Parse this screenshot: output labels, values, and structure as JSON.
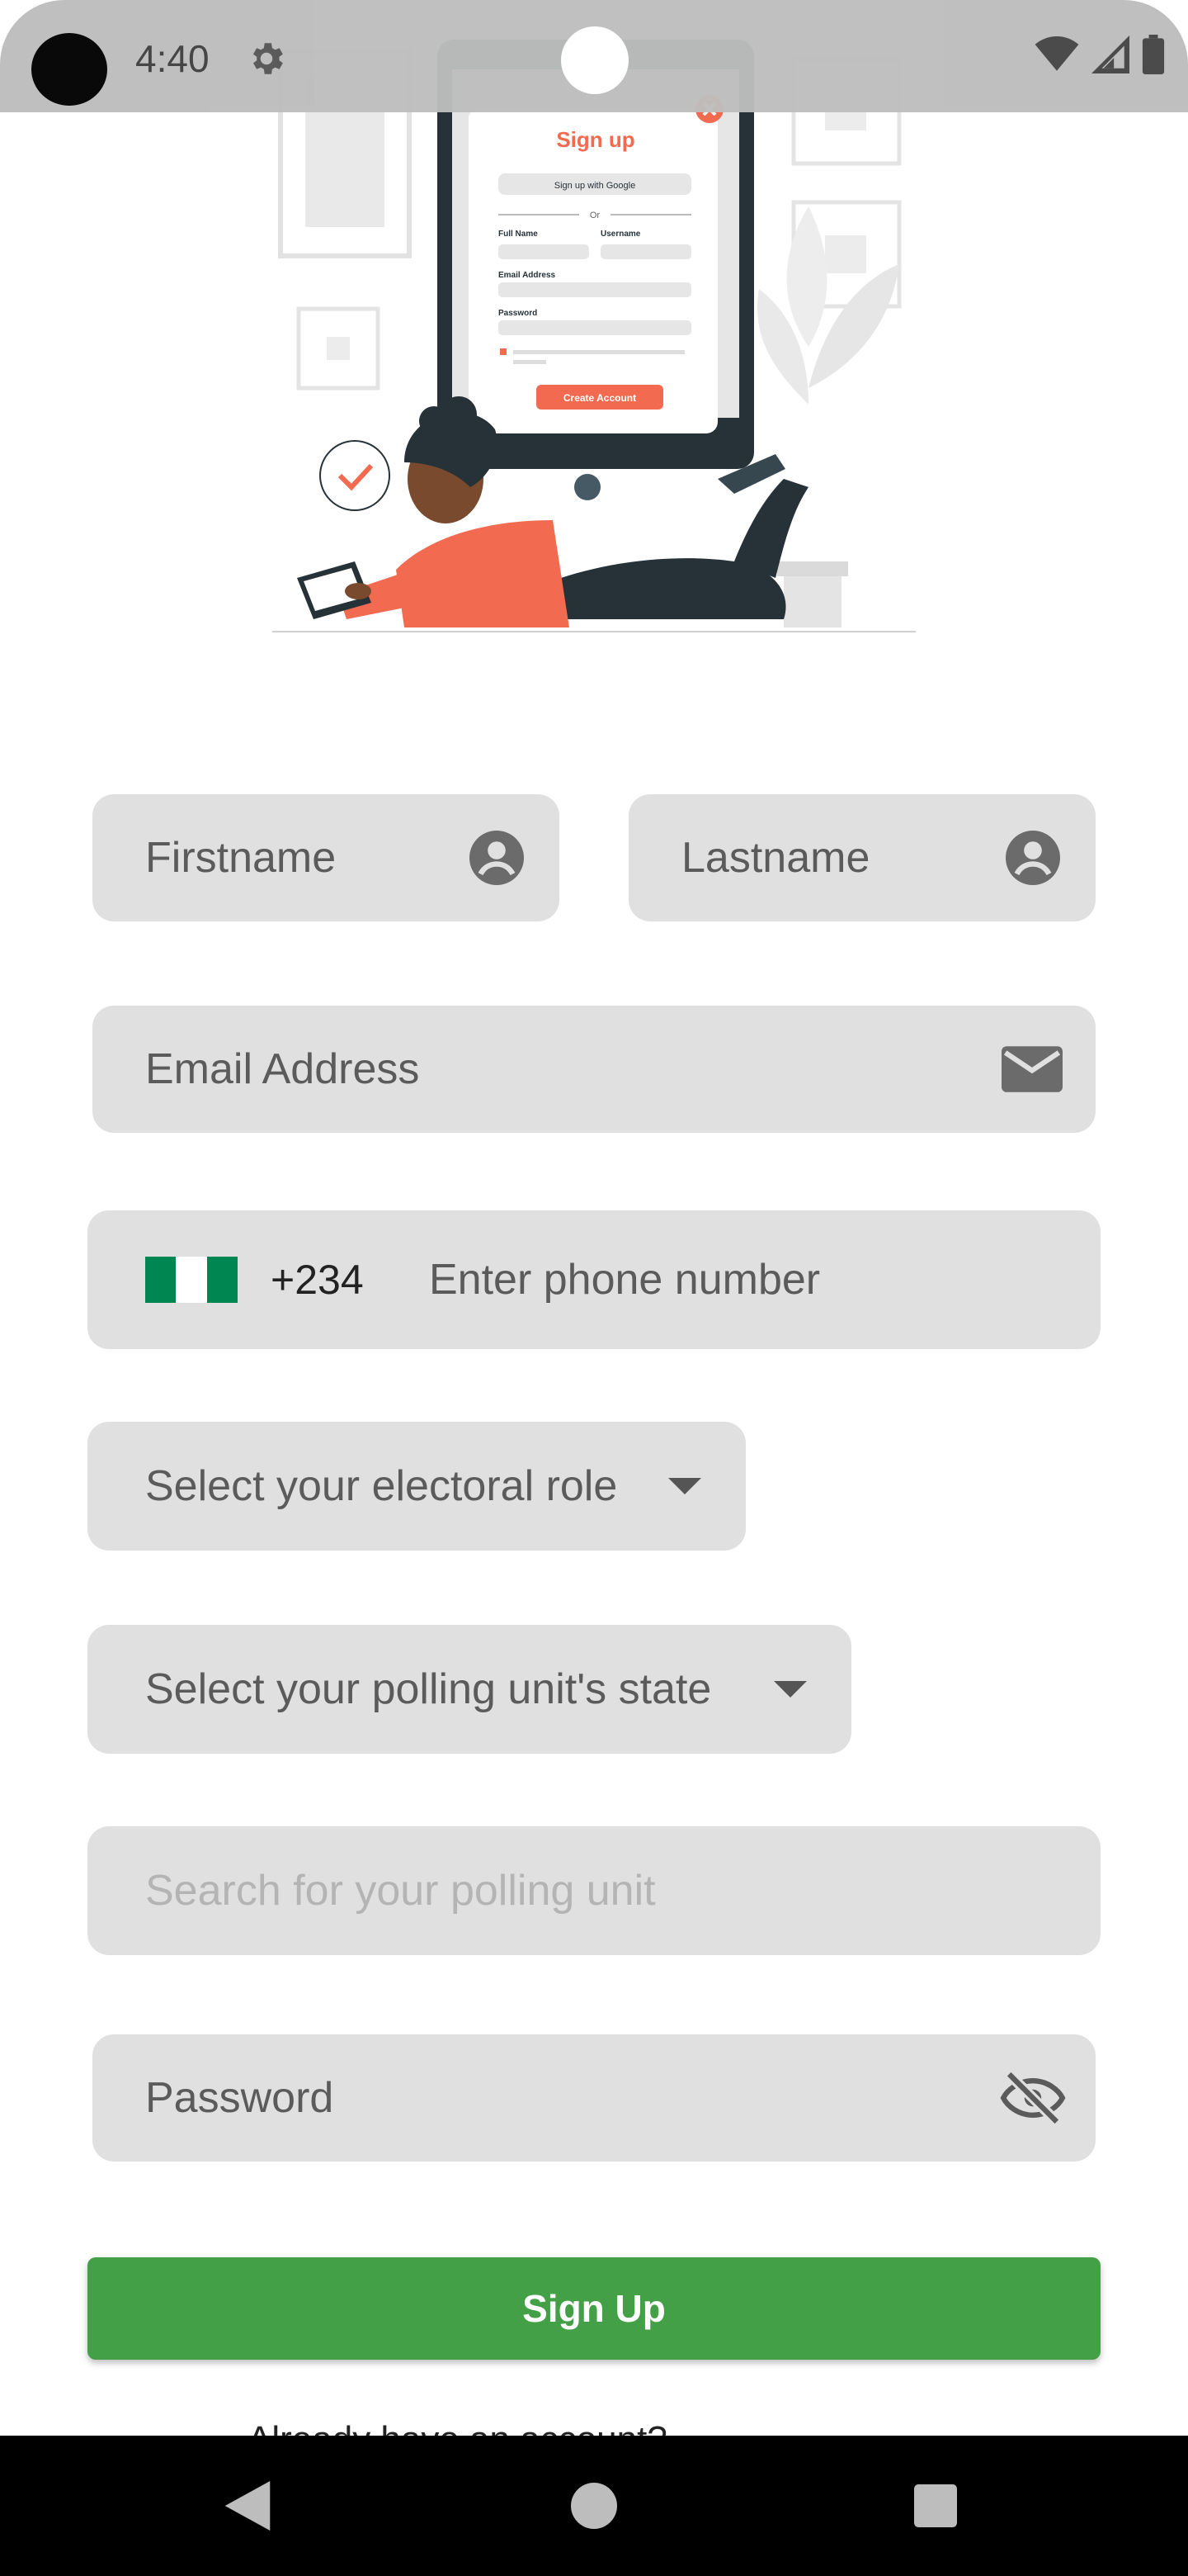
{
  "status_bar": {
    "time": "4:40"
  },
  "form": {
    "firstname_placeholder": "Firstname",
    "lastname_placeholder": "Lastname",
    "email_placeholder": "Email Address",
    "phone": {
      "country_code": "+234",
      "placeholder": "Enter phone number",
      "flag": "nigeria-flag"
    },
    "electoral_role_placeholder": "Select your electoral role",
    "polling_state_placeholder": "Select your polling unit's state",
    "polling_unit_placeholder": "Search for your polling unit",
    "password_placeholder": "Password",
    "signup_label": "Sign Up",
    "account_prompt": "Already have an account?"
  },
  "illustration": {
    "card_title": "Sign up",
    "google_button": "Sign up with Google",
    "or_divider": "Or",
    "full_name": "Full Name",
    "username": "Username",
    "email": "Email Address",
    "password": "Password",
    "create_account": "Create Account"
  },
  "colors": {
    "accent_green": "#43a047",
    "field_bg": "#e0e0e0",
    "illustration_accent": "#f26a4f"
  }
}
